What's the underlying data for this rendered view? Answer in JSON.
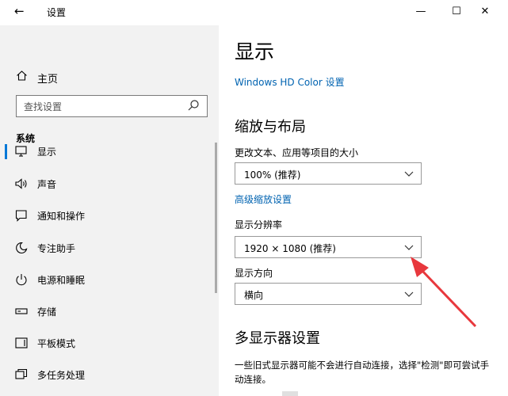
{
  "window": {
    "title": "设置",
    "back_icon": "arrow-left-icon",
    "controls": {
      "minimize": "—",
      "maximize": "☐",
      "close": "✕"
    }
  },
  "sidebar": {
    "home_label": "主页",
    "search_placeholder": "查找设置",
    "section_title": "系统",
    "items": [
      {
        "label": "显示",
        "icon": "monitor-icon",
        "selected": true
      },
      {
        "label": "声音",
        "icon": "speaker-icon"
      },
      {
        "label": "通知和操作",
        "icon": "notification-icon"
      },
      {
        "label": "专注助手",
        "icon": "moon-icon"
      },
      {
        "label": "电源和睡眠",
        "icon": "power-icon"
      },
      {
        "label": "存储",
        "icon": "storage-icon"
      },
      {
        "label": "平板模式",
        "icon": "tablet-icon"
      },
      {
        "label": "多任务处理",
        "icon": "multitask-icon"
      }
    ]
  },
  "main": {
    "title": "显示",
    "hdr_cut": "",
    "hd_color_link": "Windows HD Color 设置",
    "scale_section": "缩放与布局",
    "scale_label": "更改文本、应用等项目的大小",
    "scale_value": "100% (推荐)",
    "advanced_scaling_link": "高级缩放设置",
    "resolution_label": "显示分辨率",
    "resolution_value": "1920 × 1080 (推荐)",
    "orientation_label": "显示方向",
    "orientation_value": "横向",
    "multi_display_section": "多显示器设置",
    "multi_display_text": "一些旧式显示器可能不会进行自动连接，选择\"检测\"即可尝试手动连接。"
  },
  "annotation": {
    "color": "#e8383d"
  }
}
